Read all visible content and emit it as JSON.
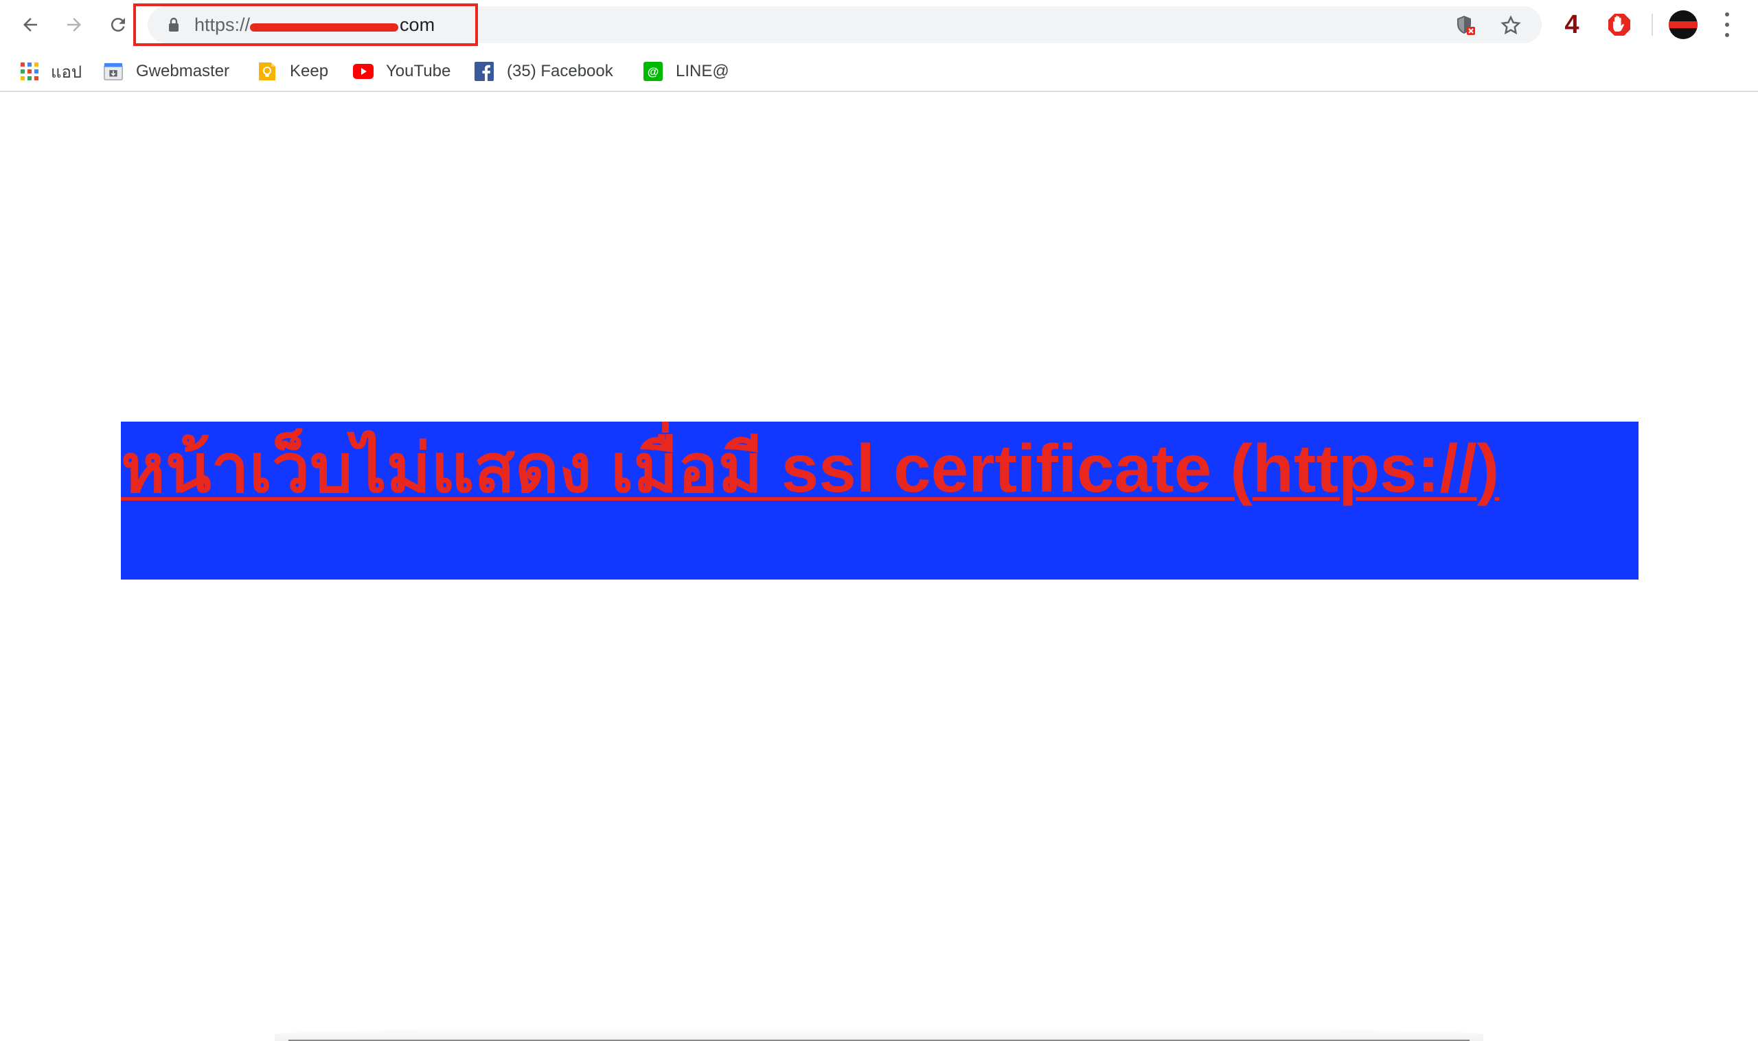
{
  "toolbar": {
    "url_scheme": "https://",
    "url_tail": "com",
    "extension_badge": "4"
  },
  "bookmarks": [
    {
      "label": "แอป",
      "icon": "apps-grid-icon"
    },
    {
      "label": "Gwebmaster",
      "icon": "webmaster-icon"
    },
    {
      "label": "Keep",
      "icon": "keep-bulb-icon"
    },
    {
      "label": "YouTube",
      "icon": "youtube-icon"
    },
    {
      "label": "(35) Facebook",
      "icon": "facebook-icon"
    },
    {
      "label": "LINE@",
      "icon": "line-at-icon"
    }
  ],
  "page": {
    "heading": "หน้าเว็บไม่แสดง เมื่อมี ssl certificate (https://)"
  },
  "colors": {
    "banner_bg": "#1238ff",
    "heading_text": "#e8271e",
    "highlight_box": "#e8271e"
  }
}
